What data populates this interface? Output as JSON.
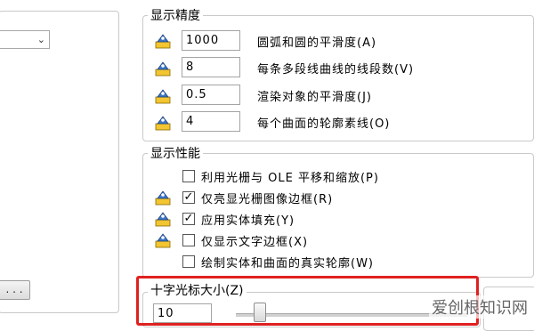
{
  "left": {
    "more_button_label": ". . ."
  },
  "display_precision": {
    "title": "显示精度",
    "rows": [
      {
        "value": "1000",
        "label": "圆弧和圆的平滑度(A)"
      },
      {
        "value": "8",
        "label": "每条多段线曲线的线段数(V)"
      },
      {
        "value": "0.5",
        "label": "渲染对象的平滑度(J)"
      },
      {
        "value": "4",
        "label": "每个曲面的轮廓素线(O)"
      }
    ]
  },
  "display_performance": {
    "title": "显示性能",
    "items": [
      {
        "label": "利用光栅与 OLE 平移和缩放(P)",
        "checked": false,
        "check_mark": ""
      },
      {
        "label": "仅亮显光栅图像边框(R)",
        "checked": true,
        "check_mark": "✓"
      },
      {
        "label": "应用实体填充(Y)",
        "checked": true,
        "check_mark": "✓"
      },
      {
        "label": "仅显示文字边框(X)",
        "checked": false,
        "check_mark": ""
      },
      {
        "label": "绘制实体和曲面的真实轮廓(W)",
        "checked": false,
        "check_mark": ""
      }
    ]
  },
  "crosshair": {
    "title": "十字光标大小(Z)",
    "value": "10"
  },
  "watermark": "爱创根知识网"
}
